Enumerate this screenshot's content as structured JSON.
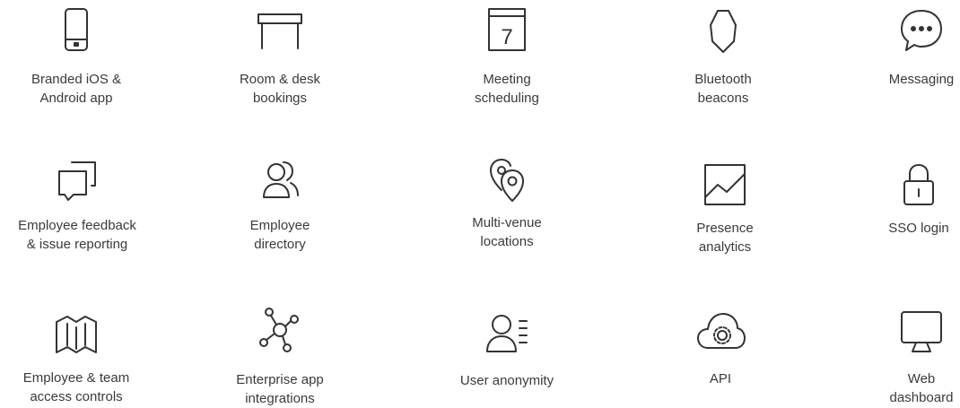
{
  "features": [
    {
      "label": "Branded iOS &\nAndroid app",
      "icon": "mobile-phone-icon"
    },
    {
      "label": "Room & desk\nbookings",
      "icon": "desk-icon"
    },
    {
      "label": "Meeting\nscheduling",
      "icon": "calendar-icon",
      "calendar_day": "7"
    },
    {
      "label": "Bluetooth\nbeacons",
      "icon": "beacon-icon"
    },
    {
      "label": "Messaging",
      "icon": "chat-bubble-icon"
    },
    {
      "label": "Employee feedback\n& issue reporting",
      "icon": "feedback-icon"
    },
    {
      "label": "Employee\ndirectory",
      "icon": "people-icon"
    },
    {
      "label": "Multi-venue\nlocations",
      "icon": "location-pins-icon"
    },
    {
      "label": "Presence\nanalytics",
      "icon": "analytics-chart-icon"
    },
    {
      "label": "SSO login",
      "icon": "lock-icon"
    },
    {
      "label": "Employee & team\naccess controls",
      "icon": "map-icon"
    },
    {
      "label": "Enterprise app\nintegrations",
      "icon": "network-icon"
    },
    {
      "label": "User anonymity",
      "icon": "user-anonymity-icon"
    },
    {
      "label": "API",
      "icon": "cloud-gear-icon"
    },
    {
      "label": "Web\ndashboard",
      "icon": "monitor-icon"
    }
  ]
}
